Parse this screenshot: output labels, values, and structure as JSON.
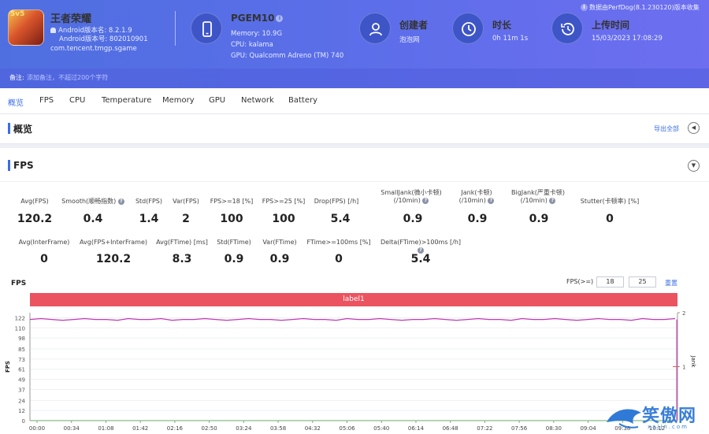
{
  "header": {
    "app_name": "王者荣耀",
    "app_level": "5v5",
    "android_version_name": "Android版本名: 8.2.1.9",
    "android_version_code": "Android版本号: 802010901",
    "package": "com.tencent.tmgp.sgame",
    "device_name": "PGEM10",
    "device_memory": "Memory: 10.9G",
    "device_cpu": "CPU: kalama",
    "device_gpu": "GPU: Qualcomm Adreno (TM) 740",
    "creator_title": "创建者",
    "creator_value": "泡泡网",
    "duration_title": "时长",
    "duration_value": "0h 11m 1s",
    "upload_title": "上传时间",
    "upload_value": "15/03/2023 17:08:29",
    "data_source": "数据由PerfDog(8.1.230120)版本收集",
    "note_label": "备注:",
    "note_placeholder": "添加备注，不超过200个字符"
  },
  "tabs": [
    "概览",
    "FPS",
    "CPU",
    "Temperature",
    "Memory",
    "GPU",
    "Network",
    "Battery"
  ],
  "overview": {
    "title": "概览",
    "export": "导出全部"
  },
  "fps": {
    "title": "FPS",
    "row1_labels": [
      "Avg(FPS)",
      "Smooth(顺畅指数)",
      "Std(FPS)",
      "Var(FPS)",
      "FPS>=18 [%]",
      "FPS>=25 [%]",
      "Drop(FPS) [/h]",
      "SmallJank(微小卡顿)",
      "(/10min)",
      "Jank(卡顿)",
      "(/10min)",
      "BigJank(严重卡顿)",
      "(/10min)",
      "Stutter(卡顿率) [%]"
    ],
    "row1_values": [
      "120.2",
      "0.4",
      "1.4",
      "2",
      "100",
      "100",
      "5.4",
      "0.9",
      "0.9",
      "0.9",
      "0"
    ],
    "row2_labels": [
      "Avg(InterFrame)",
      "Avg(FPS+InterFrame)",
      "Avg(FTime) [ms]",
      "Std(FTime)",
      "Var(FTime)",
      "FTime>=100ms [%]",
      "Delta(FTime)>100ms [/h]"
    ],
    "row2_values": [
      "0",
      "120.2",
      "8.3",
      "0.9",
      "0.9",
      "0",
      "5.4"
    ],
    "info_mark": "?"
  },
  "chart_controls": {
    "title": "FPS",
    "filter_label": "FPS(>=)",
    "filter_min": "18",
    "filter_max": "25",
    "reset": "重置",
    "label_bar": "label1",
    "collapse_icon": "chevron-left-icon",
    "expand_icon": "chevron-down-icon"
  },
  "chart_data": {
    "type": "line",
    "title": "",
    "ylabel": "FPS",
    "y2label": "Jank",
    "yticks": [
      0,
      12,
      24,
      37,
      49,
      61,
      73,
      85,
      98,
      110,
      122
    ],
    "ylim": [
      0,
      128
    ],
    "y2ticks": [
      1,
      2
    ],
    "x_tick_labels": [
      "00:00",
      "00:34",
      "01:08",
      "01:42",
      "02:16",
      "02:50",
      "03:24",
      "03:58",
      "04:32",
      "05:06",
      "05:40",
      "06:14",
      "06:48",
      "07:22",
      "07:56",
      "08:30",
      "09:04",
      "09:38",
      "10:12"
    ],
    "series": [
      {
        "values": [
          120,
          121,
          120,
          119,
          120,
          121,
          120,
          120,
          119,
          121,
          120,
          120,
          121,
          119,
          120,
          120,
          121,
          120,
          119,
          120,
          121,
          120,
          120,
          119,
          120,
          121,
          120,
          120,
          119,
          121,
          120,
          120,
          121,
          120,
          119,
          120,
          120,
          121,
          120,
          119,
          120,
          121,
          120,
          120,
          119,
          121,
          120,
          120,
          121,
          120,
          119,
          120,
          121,
          120,
          120,
          119,
          121,
          120,
          120,
          121
        ]
      },
      {
        "values": [
          0,
          0,
          0,
          0,
          0,
          0,
          0,
          0,
          0,
          0,
          0,
          0,
          0,
          0,
          0,
          0,
          0,
          0,
          0,
          0,
          0,
          0,
          0,
          0,
          0,
          0,
          0,
          0,
          0,
          0,
          0,
          0,
          0,
          0,
          0,
          0,
          0,
          0,
          0,
          0,
          0,
          0,
          0,
          0,
          0,
          0,
          0,
          0,
          0,
          0,
          0,
          0,
          0,
          0,
          0,
          0,
          0,
          0,
          0,
          0
        ]
      }
    ],
    "colors": {
      "fps": "#c239b3",
      "jank": "#e05a5a",
      "axis": "#999999"
    }
  },
  "watermark": {
    "text": "笑傲网",
    "url": "xajjn.com"
  }
}
